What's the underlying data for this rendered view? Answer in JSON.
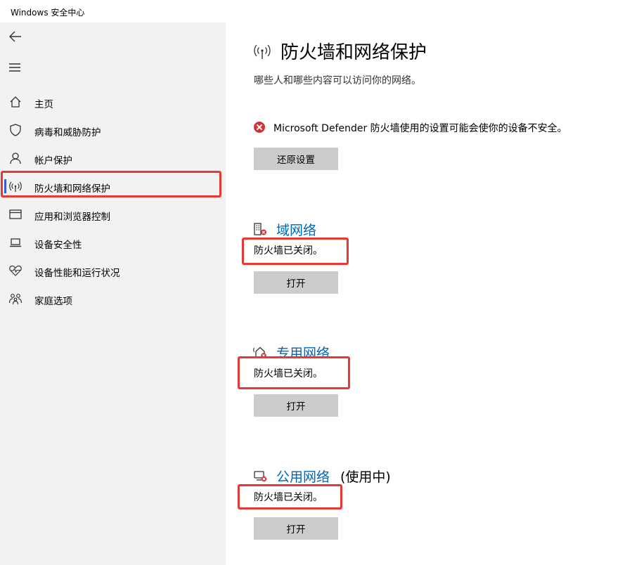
{
  "window": {
    "title": "Windows 安全中心"
  },
  "sidebar": {
    "items": [
      {
        "label": "主页",
        "icon": "home-icon"
      },
      {
        "label": "病毒和威胁防护",
        "icon": "shield-icon"
      },
      {
        "label": "帐户保护",
        "icon": "person-icon"
      },
      {
        "label": "防火墙和网络保护",
        "icon": "wifi-antenna-icon",
        "active": true
      },
      {
        "label": "应用和浏览器控制",
        "icon": "browser-window-icon"
      },
      {
        "label": "设备安全性",
        "icon": "laptop-icon"
      },
      {
        "label": "设备性能和运行状况",
        "icon": "heart-pulse-icon"
      },
      {
        "label": "家庭选项",
        "icon": "family-icon"
      }
    ]
  },
  "main": {
    "title": "防火墙和网络保护",
    "subtitle": "哪些人和哪些内容可以访问你的网络。",
    "warning": "Microsoft Defender 防火墙使用的设置可能会使你的设备不安全。",
    "restore_button": "还原设置",
    "networks": [
      {
        "name": "域网络",
        "suffix": "",
        "status": "防火墙已关闭。",
        "button": "打开",
        "icon": "domain-network-icon"
      },
      {
        "name": "专用网络",
        "suffix": "",
        "status": "防火墙已关闭。",
        "button": "打开",
        "icon": "private-network-icon"
      },
      {
        "name": "公用网络",
        "suffix": "(使用中)",
        "status": "防火墙已关闭。",
        "button": "打开",
        "icon": "public-network-icon"
      }
    ]
  },
  "colors": {
    "accent": "#0067b8",
    "error": "#d13438",
    "highlight": "#e53935",
    "sidebar_bg": "#f2f2f2",
    "button_bg": "#cccccc"
  }
}
